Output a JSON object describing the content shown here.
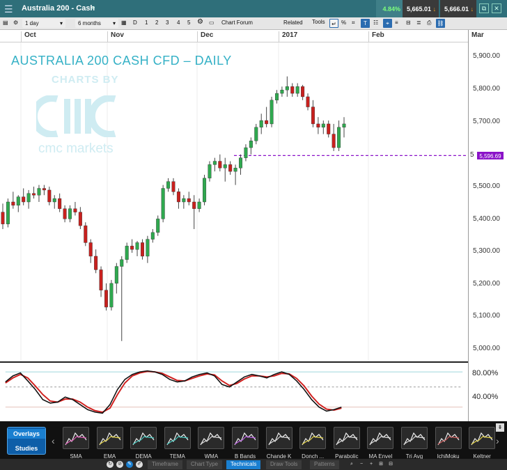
{
  "titlebar": {
    "symbol": "Australia 200 - Cash",
    "change": "4.84%",
    "bid": "5,665.01",
    "ask": "5,666.01"
  },
  "toolbar": {
    "interval": "1 day",
    "range": "6 months",
    "day_buttons": [
      "D",
      "1",
      "2",
      "3",
      "4",
      "5"
    ],
    "chart_forum": "Chart Forum",
    "related": "Related",
    "tools": "Tools"
  },
  "axis": {
    "months": [
      "Oct",
      "Nov",
      "Dec",
      "2017",
      "Feb",
      "Mar"
    ],
    "price_labels": [
      "5,900.00",
      "5,800.00",
      "5,700.00",
      "5,500.00",
      "5,400.00",
      "5,300.00",
      "5,200.00",
      "5,100.00",
      "5,000.00"
    ],
    "current_price_tag": "5,596.69",
    "current_price_partial": "5"
  },
  "chart": {
    "title": "AUSTRALIA 200 CASH CFD – DAILY",
    "watermark_top": "CHARTS BY",
    "watermark_name": "cmc markets",
    "colors": {
      "up": "#2fa84f",
      "down": "#c8201e",
      "line": "#8a12c8"
    }
  },
  "chart_data": {
    "type": "candlestick",
    "ylim": [
      4990,
      5930
    ],
    "reference_line": 5596.69,
    "candles": [
      {
        "o": 5430,
        "h": 5455,
        "l": 5380,
        "c": 5395
      },
      {
        "o": 5395,
        "h": 5470,
        "l": 5385,
        "c": 5460
      },
      {
        "o": 5460,
        "h": 5490,
        "l": 5440,
        "c": 5450
      },
      {
        "o": 5450,
        "h": 5480,
        "l": 5430,
        "c": 5475
      },
      {
        "o": 5475,
        "h": 5500,
        "l": 5450,
        "c": 5460
      },
      {
        "o": 5460,
        "h": 5495,
        "l": 5440,
        "c": 5485
      },
      {
        "o": 5485,
        "h": 5505,
        "l": 5470,
        "c": 5480
      },
      {
        "o": 5480,
        "h": 5510,
        "l": 5460,
        "c": 5500
      },
      {
        "o": 5500,
        "h": 5510,
        "l": 5480,
        "c": 5495
      },
      {
        "o": 5495,
        "h": 5505,
        "l": 5450,
        "c": 5460
      },
      {
        "o": 5460,
        "h": 5480,
        "l": 5440,
        "c": 5470
      },
      {
        "o": 5470,
        "h": 5485,
        "l": 5430,
        "c": 5440
      },
      {
        "o": 5440,
        "h": 5450,
        "l": 5400,
        "c": 5410
      },
      {
        "o": 5410,
        "h": 5450,
        "l": 5400,
        "c": 5440
      },
      {
        "o": 5440,
        "h": 5460,
        "l": 5420,
        "c": 5430
      },
      {
        "o": 5430,
        "h": 5445,
        "l": 5380,
        "c": 5390
      },
      {
        "o": 5390,
        "h": 5400,
        "l": 5330,
        "c": 5340
      },
      {
        "o": 5340,
        "h": 5350,
        "l": 5280,
        "c": 5300
      },
      {
        "o": 5300,
        "h": 5320,
        "l": 5250,
        "c": 5260
      },
      {
        "o": 5260,
        "h": 5270,
        "l": 5180,
        "c": 5200
      },
      {
        "o": 5200,
        "h": 5220,
        "l": 5140,
        "c": 5150
      },
      {
        "o": 5150,
        "h": 5230,
        "l": 5140,
        "c": 5220
      },
      {
        "o": 5220,
        "h": 5280,
        "l": 5190,
        "c": 5270
      },
      {
        "o": 5270,
        "h": 5300,
        "l": 5050,
        "c": 5290
      },
      {
        "o": 5290,
        "h": 5340,
        "l": 5280,
        "c": 5330
      },
      {
        "o": 5330,
        "h": 5350,
        "l": 5310,
        "c": 5320
      },
      {
        "o": 5320,
        "h": 5345,
        "l": 5300,
        "c": 5340
      },
      {
        "o": 5340,
        "h": 5350,
        "l": 5290,
        "c": 5300
      },
      {
        "o": 5300,
        "h": 5360,
        "l": 5280,
        "c": 5350
      },
      {
        "o": 5350,
        "h": 5380,
        "l": 5340,
        "c": 5370
      },
      {
        "o": 5370,
        "h": 5420,
        "l": 5360,
        "c": 5410
      },
      {
        "o": 5410,
        "h": 5510,
        "l": 5400,
        "c": 5500
      },
      {
        "o": 5500,
        "h": 5530,
        "l": 5490,
        "c": 5520
      },
      {
        "o": 5520,
        "h": 5530,
        "l": 5480,
        "c": 5490
      },
      {
        "o": 5490,
        "h": 5500,
        "l": 5440,
        "c": 5460
      },
      {
        "o": 5460,
        "h": 5480,
        "l": 5440,
        "c": 5470
      },
      {
        "o": 5470,
        "h": 5490,
        "l": 5450,
        "c": 5460
      },
      {
        "o": 5460,
        "h": 5480,
        "l": 5380,
        "c": 5440
      },
      {
        "o": 5440,
        "h": 5470,
        "l": 5430,
        "c": 5460
      },
      {
        "o": 5460,
        "h": 5540,
        "l": 5450,
        "c": 5530
      },
      {
        "o": 5530,
        "h": 5580,
        "l": 5520,
        "c": 5570
      },
      {
        "o": 5570,
        "h": 5590,
        "l": 5550,
        "c": 5580
      },
      {
        "o": 5580,
        "h": 5600,
        "l": 5550,
        "c": 5560
      },
      {
        "o": 5560,
        "h": 5590,
        "l": 5520,
        "c": 5570
      },
      {
        "o": 5570,
        "h": 5580,
        "l": 5540,
        "c": 5550
      },
      {
        "o": 5550,
        "h": 5570,
        "l": 5510,
        "c": 5560
      },
      {
        "o": 5560,
        "h": 5600,
        "l": 5540,
        "c": 5590
      },
      {
        "o": 5590,
        "h": 5630,
        "l": 5580,
        "c": 5620
      },
      {
        "o": 5620,
        "h": 5650,
        "l": 5600,
        "c": 5640
      },
      {
        "o": 5640,
        "h": 5690,
        "l": 5630,
        "c": 5680
      },
      {
        "o": 5680,
        "h": 5720,
        "l": 5660,
        "c": 5700
      },
      {
        "o": 5700,
        "h": 5740,
        "l": 5680,
        "c": 5690
      },
      {
        "o": 5690,
        "h": 5770,
        "l": 5680,
        "c": 5760
      },
      {
        "o": 5760,
        "h": 5790,
        "l": 5750,
        "c": 5780
      },
      {
        "o": 5780,
        "h": 5800,
        "l": 5770,
        "c": 5790
      },
      {
        "o": 5790,
        "h": 5830,
        "l": 5770,
        "c": 5800
      },
      {
        "o": 5800,
        "h": 5810,
        "l": 5770,
        "c": 5780
      },
      {
        "o": 5780,
        "h": 5810,
        "l": 5770,
        "c": 5800
      },
      {
        "o": 5800,
        "h": 5805,
        "l": 5760,
        "c": 5770
      },
      {
        "o": 5770,
        "h": 5780,
        "l": 5730,
        "c": 5740
      },
      {
        "o": 5740,
        "h": 5760,
        "l": 5680,
        "c": 5690
      },
      {
        "o": 5690,
        "h": 5710,
        "l": 5660,
        "c": 5680
      },
      {
        "o": 5680,
        "h": 5700,
        "l": 5660,
        "c": 5690
      },
      {
        "o": 5690,
        "h": 5700,
        "l": 5650,
        "c": 5660
      },
      {
        "o": 5660,
        "h": 5690,
        "l": 5610,
        "c": 5620
      },
      {
        "o": 5620,
        "h": 5700,
        "l": 5610,
        "c": 5680
      },
      {
        "o": 5680,
        "h": 5710,
        "l": 5650,
        "c": 5690
      }
    ],
    "oscillator": {
      "levels": [
        80,
        40
      ],
      "ylim": [
        0,
        100
      ],
      "k": [
        70,
        82,
        88,
        72,
        55,
        35,
        28,
        30,
        40,
        35,
        25,
        15,
        10,
        8,
        25,
        55,
        75,
        85,
        90,
        92,
        90,
        85,
        75,
        70,
        72,
        80,
        85,
        88,
        82,
        65,
        60,
        70,
        80,
        85,
        82,
        78,
        85,
        90,
        85,
        72,
        55,
        35,
        20,
        12,
        15,
        20
      ],
      "d": [
        68,
        78,
        85,
        78,
        62,
        45,
        32,
        30,
        36,
        36,
        30,
        20,
        13,
        10,
        18,
        45,
        68,
        82,
        88,
        91,
        90,
        87,
        80,
        73,
        72,
        77,
        82,
        86,
        84,
        72,
        63,
        67,
        76,
        82,
        82,
        80,
        82,
        87,
        86,
        77,
        62,
        42,
        26,
        16,
        14,
        18
      ]
    }
  },
  "oscillator_labels": [
    "80.00%",
    "40.00%"
  ],
  "bottom": {
    "overlays": "Overlays",
    "studies": "Studies",
    "tiles": [
      "SMA",
      "EMA",
      "DEMA",
      "TEMA",
      "WMA",
      "B Bands",
      "Chande K",
      "Donch ...",
      "Parabolic",
      "MA Envel",
      "Tri Avg",
      "IchiMoku",
      "Keltner"
    ],
    "tabs": [
      "Timeframe",
      "Chart Type",
      "Technicals",
      "Draw Tools",
      "Patterns"
    ]
  }
}
